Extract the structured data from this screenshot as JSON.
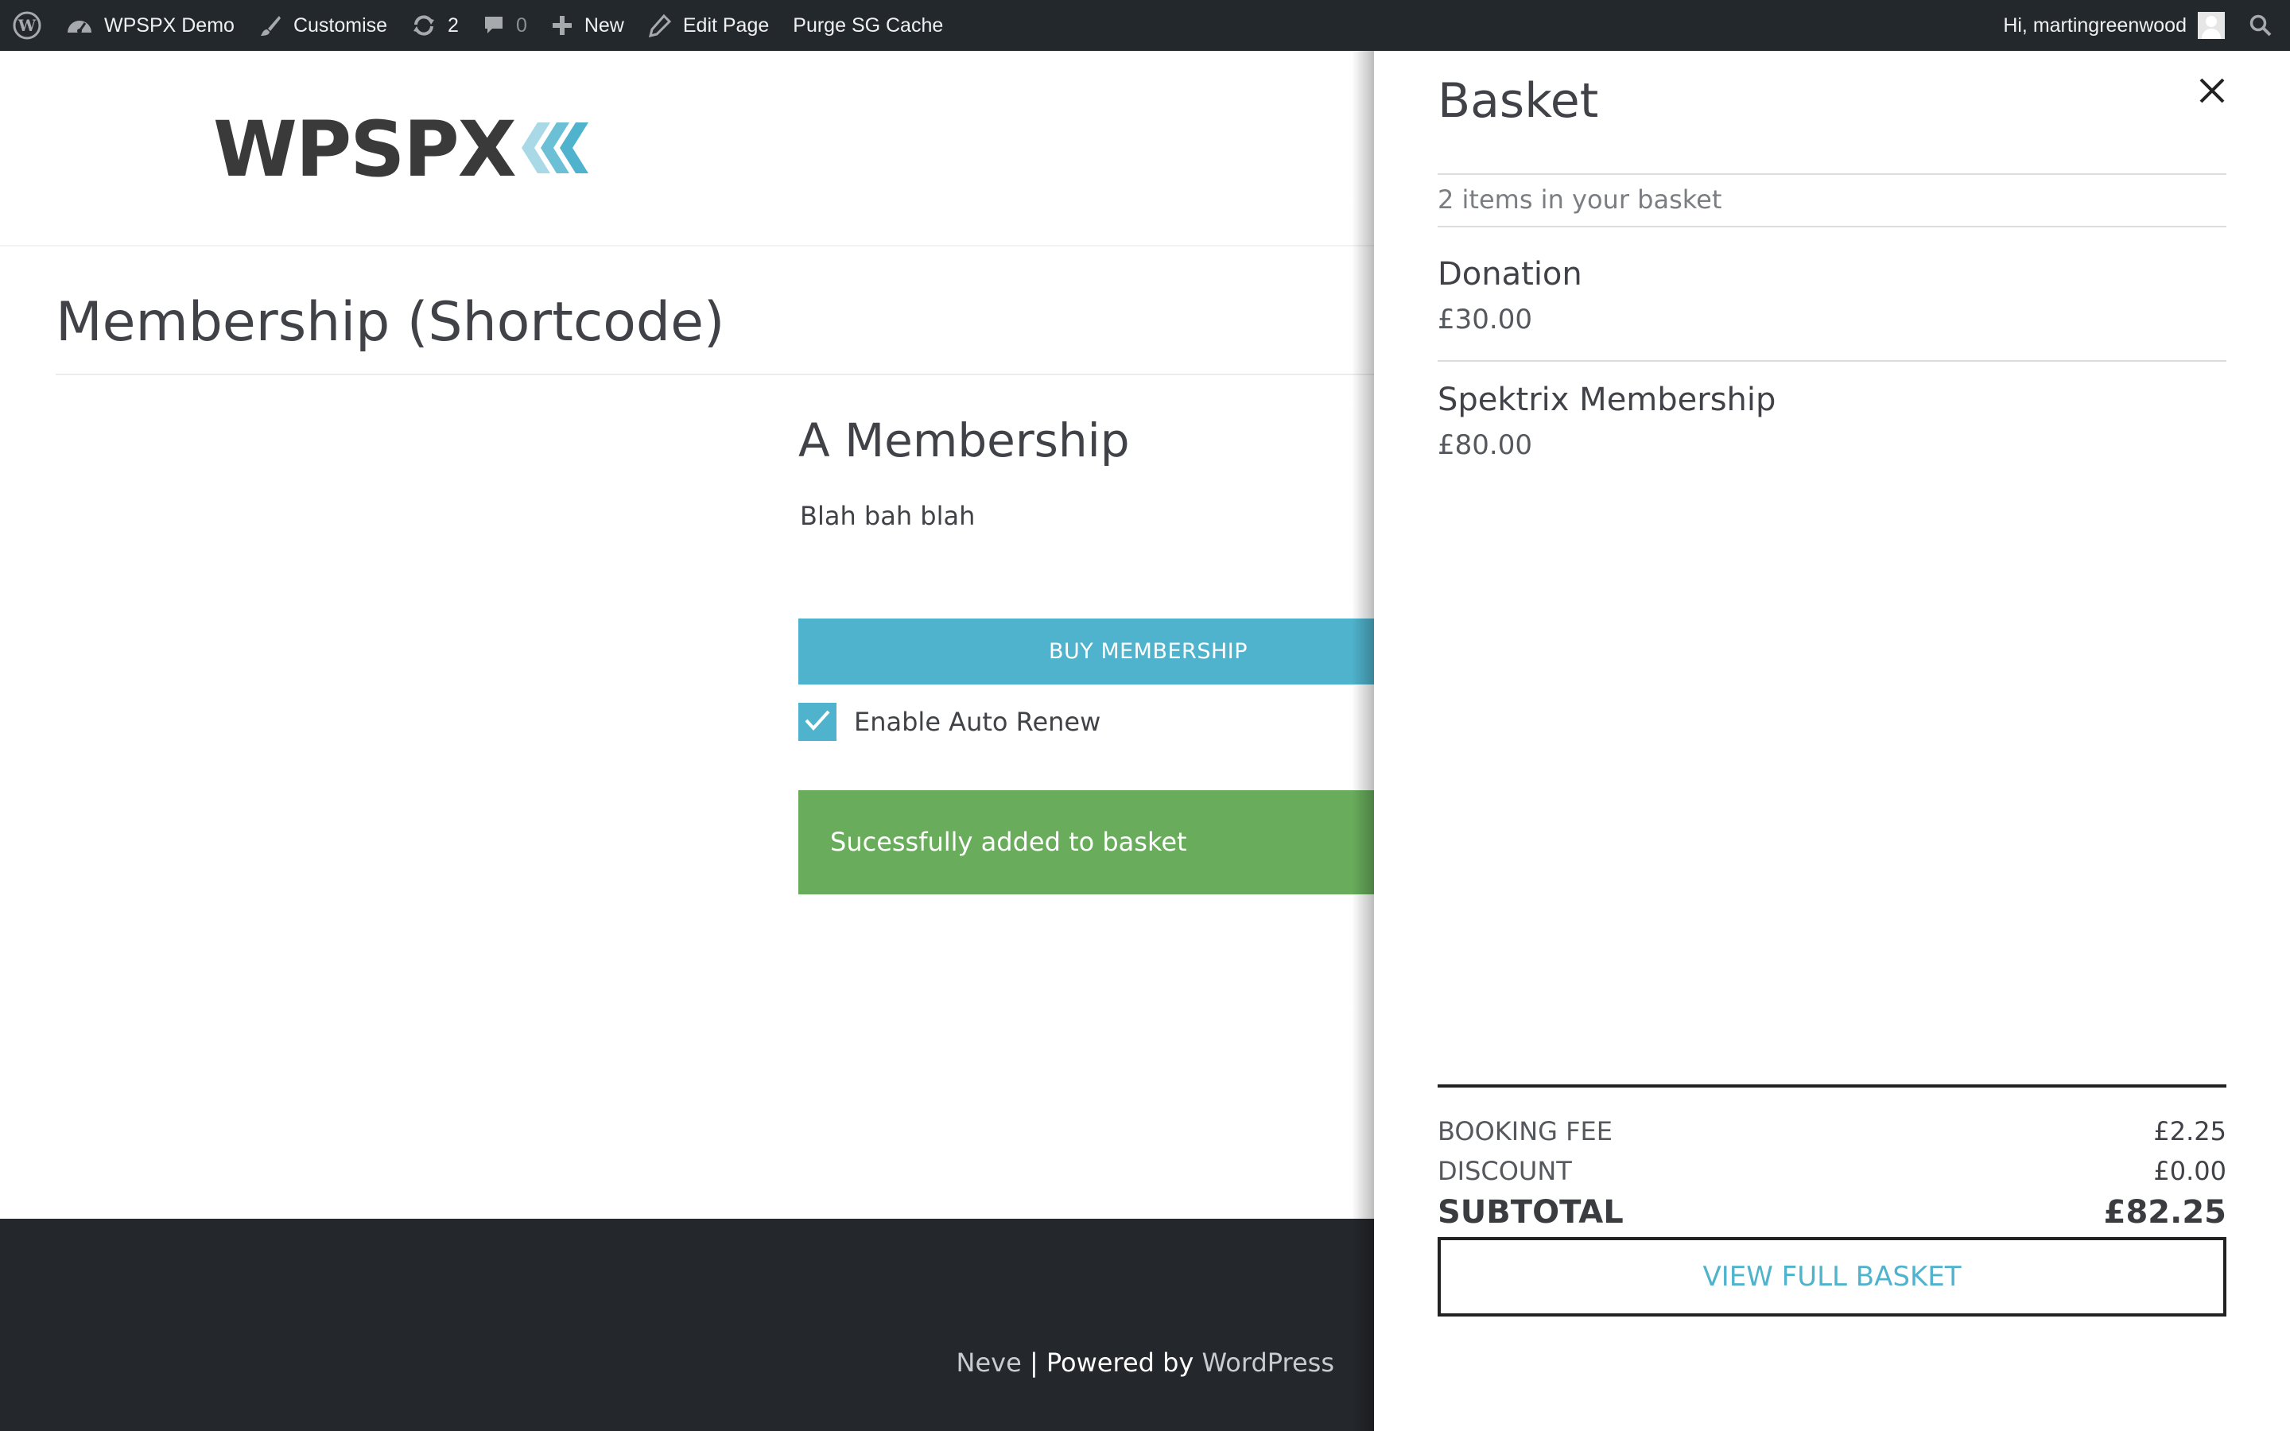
{
  "admin_bar": {
    "site_name": "WPSPX Demo",
    "customise": "Customise",
    "updates_count": "2",
    "comments_count": "0",
    "new": "New",
    "edit_page": "Edit Page",
    "purge_cache": "Purge SG Cache",
    "greeting": "Hi, martingreenwood"
  },
  "header": {
    "logo_text": "WPSPX",
    "logo_accent_color": "#4fb3cd"
  },
  "page": {
    "title": "Membership (Shortcode)",
    "product_title": "A Membership",
    "product_description": "Blah bah blah",
    "buy_button": "BUY MEMBERSHIP",
    "auto_renew_label": "Enable Auto Renew",
    "auto_renew_checked": true,
    "success_message": "Sucessfully added to basket"
  },
  "footer": {
    "theme": "Neve",
    "separator": " | Powered by ",
    "platform": "WordPress"
  },
  "basket": {
    "title": "Basket",
    "items_count_text": "2 items in your basket",
    "items": [
      {
        "name": "Donation",
        "price": "£30.00"
      },
      {
        "name": "Spektrix Membership",
        "price": "£80.00"
      }
    ],
    "booking_fee_label": "BOOKING FEE",
    "booking_fee_value": "£2.25",
    "discount_label": "DISCOUNT",
    "discount_value": "£0.00",
    "subtotal_label": "SUBTOTAL",
    "subtotal_value": "£82.25",
    "view_full_basket": "VIEW FULL BASKET"
  },
  "colors": {
    "admin_bar_bg": "#23282d",
    "accent": "#4fb3cd",
    "success": "#69ad5c",
    "footer_bg": "#24272b"
  }
}
